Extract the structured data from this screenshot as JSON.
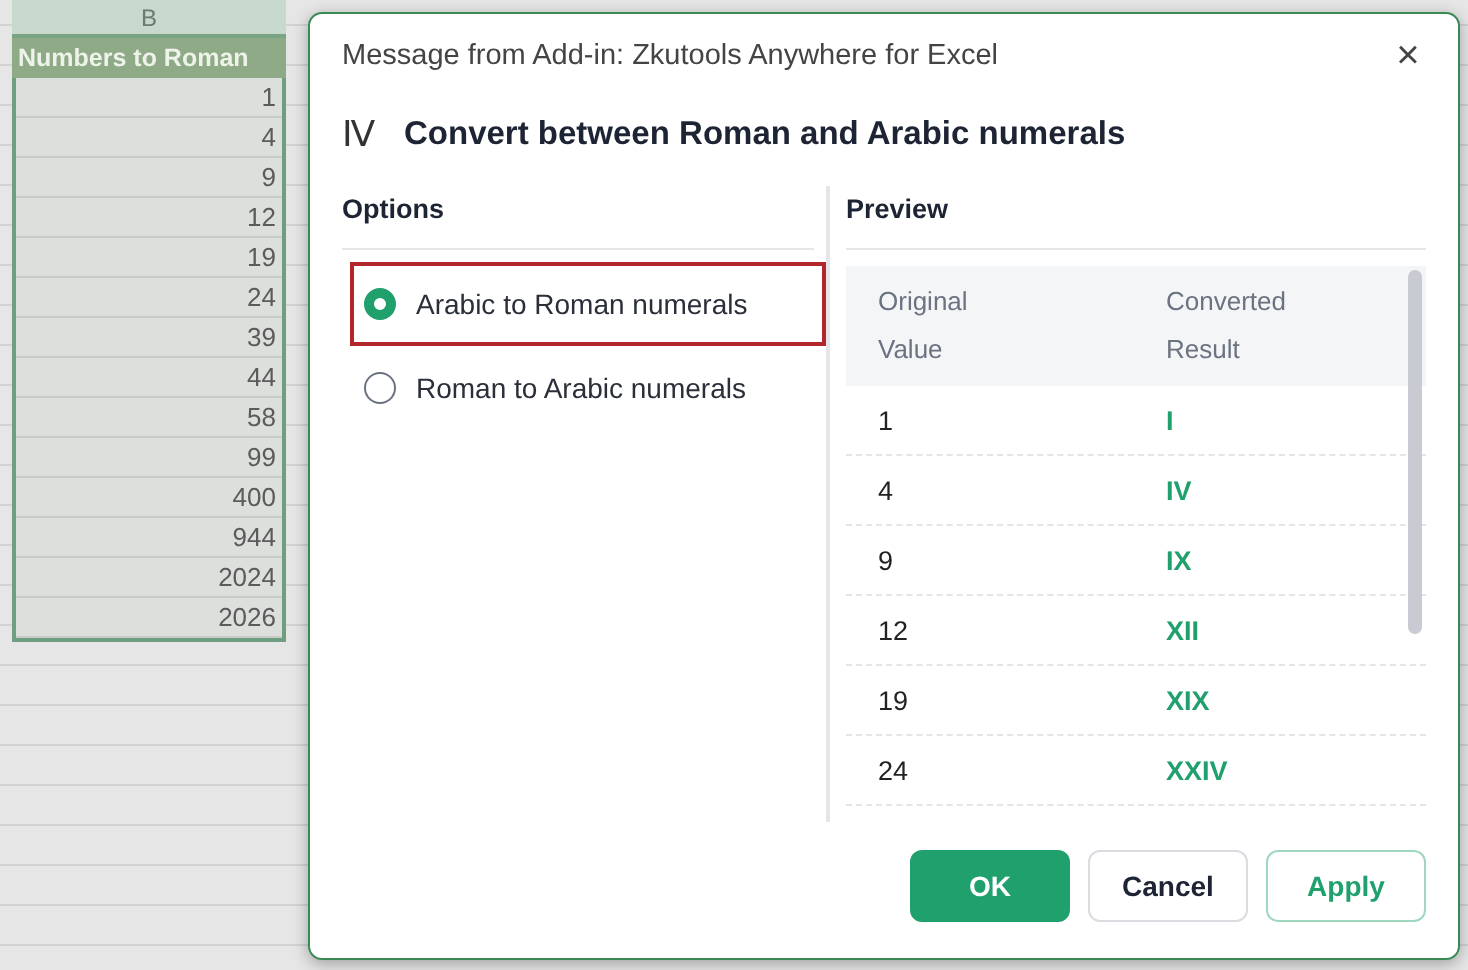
{
  "sheet": {
    "column_header": "B",
    "header_cell": "Numbers to Roman",
    "cells": [
      "1",
      "4",
      "9",
      "12",
      "19",
      "24",
      "39",
      "44",
      "58",
      "99",
      "400",
      "944",
      "2024",
      "2026"
    ]
  },
  "dialog": {
    "title": "Message from Add-in: Zkutools Anywhere for Excel",
    "close": "×",
    "heading_icon": "Ⅳ",
    "heading": "Convert between Roman and Arabic numerals",
    "options": {
      "label": "Options",
      "items": [
        {
          "label": "Arabic to Roman numerals",
          "selected": true
        },
        {
          "label": "Roman to Arabic numerals",
          "selected": false
        }
      ]
    },
    "preview": {
      "label": "Preview",
      "columns": [
        "Original Value",
        "Converted Result"
      ],
      "rows": [
        [
          "1",
          "I"
        ],
        [
          "4",
          "IV"
        ],
        [
          "9",
          "IX"
        ],
        [
          "12",
          "XII"
        ],
        [
          "19",
          "XIX"
        ],
        [
          "24",
          "XXIV"
        ]
      ]
    },
    "buttons": [
      {
        "label": "OK",
        "kind": "primary"
      },
      {
        "label": "Cancel",
        "kind": "secondary"
      },
      {
        "label": "Apply",
        "kind": "outline"
      }
    ]
  }
}
